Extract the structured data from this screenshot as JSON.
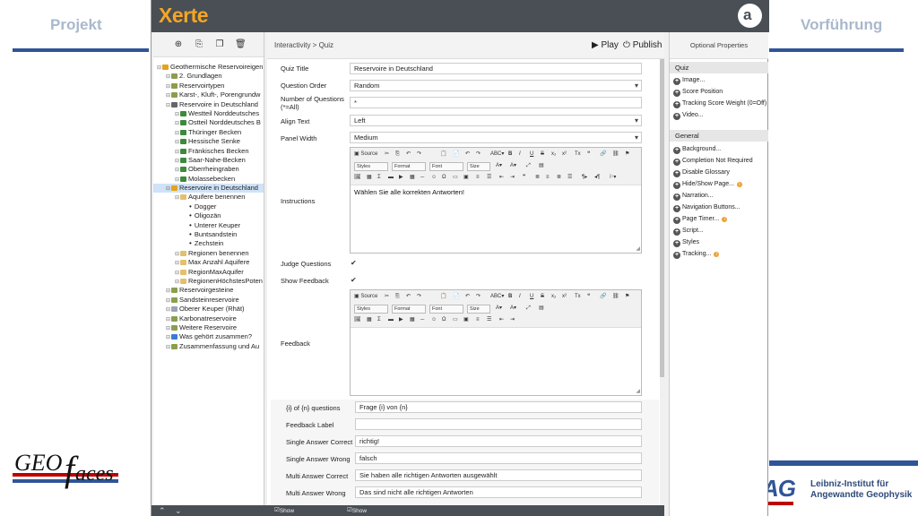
{
  "slide": {
    "left_tab": "Projekt",
    "right_tab": "Vorführung",
    "geo_logo": "GEOfaces",
    "liag_mark": "AG",
    "liag_line1": "Leibniz-Institut für",
    "liag_line2": "Angewandte Geophysik"
  },
  "app": {
    "logo": "Xerte",
    "right_logo": "a"
  },
  "tree": {
    "items": [
      {
        "label": "Geothermische Reservoireigen",
        "level": 0,
        "icon": "folder-icon",
        "color": "#e3a41c"
      },
      {
        "label": "2. Grundlagen",
        "level": 1,
        "icon": "page-icon",
        "color": "#8a9e4e"
      },
      {
        "label": "Reservoirtypen",
        "level": 1,
        "icon": "page-icon",
        "color": "#8a9e4e"
      },
      {
        "label": "Karst-, Kluft-, Porengrundw",
        "level": 1,
        "icon": "page-icon",
        "color": "#8a9e4e"
      },
      {
        "label": "Reservoire in Deutschland",
        "level": 1,
        "icon": "page-icon",
        "color": "#666666"
      },
      {
        "label": "Westteil Norddeutsches",
        "level": 2,
        "icon": "page-icon",
        "color": "#3c8a3c"
      },
      {
        "label": "Ostteil Norddeutsches B",
        "level": 2,
        "icon": "page-icon",
        "color": "#3c8a3c"
      },
      {
        "label": "Thüringer Becken",
        "level": 2,
        "icon": "page-icon",
        "color": "#3c8a3c"
      },
      {
        "label": "Hessische Senke",
        "level": 2,
        "icon": "page-icon",
        "color": "#3c8a3c"
      },
      {
        "label": "Fränkisches Becken",
        "level": 2,
        "icon": "page-icon",
        "color": "#3c8a3c"
      },
      {
        "label": "Saar-Nahe-Becken",
        "level": 2,
        "icon": "page-icon",
        "color": "#3c8a3c"
      },
      {
        "label": "Oberrheingraben",
        "level": 2,
        "icon": "page-icon",
        "color": "#3c8a3c"
      },
      {
        "label": "Molassebecken",
        "level": 2,
        "icon": "page-icon",
        "color": "#3c8a3c"
      },
      {
        "label": "Reservoire in Deutschland",
        "level": 1,
        "icon": "quiz-icon",
        "color": "#e3a41c",
        "selected": true
      },
      {
        "label": "Aquifere benennen",
        "level": 2,
        "icon": "question-icon",
        "color": "#e3c06b"
      },
      {
        "label": "Dogger",
        "level": 3,
        "icon": "bullet-icon",
        "color": "#222222"
      },
      {
        "label": "Oligozän",
        "level": 3,
        "icon": "bullet-icon",
        "color": "#222222"
      },
      {
        "label": "Unterer Keuper",
        "level": 3,
        "icon": "bullet-icon",
        "color": "#222222"
      },
      {
        "label": "Buntsandstein",
        "level": 3,
        "icon": "bullet-icon",
        "color": "#222222"
      },
      {
        "label": "Zechstein",
        "level": 3,
        "icon": "bullet-icon",
        "color": "#222222"
      },
      {
        "label": "Regionen benennen",
        "level": 2,
        "icon": "question-icon",
        "color": "#e3c06b"
      },
      {
        "label": "Max Anzahl Aquifere",
        "level": 2,
        "icon": "question-icon",
        "color": "#e3c06b"
      },
      {
        "label": "RegionMaxAquifer",
        "level": 2,
        "icon": "question-icon",
        "color": "#e3c06b"
      },
      {
        "label": "RegionenHöchstesPoten",
        "level": 2,
        "icon": "question-icon",
        "color": "#e3c06b"
      },
      {
        "label": "Reservoirgesteine",
        "level": 1,
        "icon": "page-icon",
        "color": "#8a9e4e"
      },
      {
        "label": "Sandsteinreservoire",
        "level": 1,
        "icon": "page-icon",
        "color": "#8a9e4e"
      },
      {
        "label": "Oberer Keuper (Rhät)",
        "level": 1,
        "icon": "doc-icon",
        "color": "#9aa4b4"
      },
      {
        "label": "Karbonatreservoire",
        "level": 1,
        "icon": "page-icon",
        "color": "#8a9e4e"
      },
      {
        "label": "Weitere Reservoire",
        "level": 1,
        "icon": "page-icon",
        "color": "#8a9e4e"
      },
      {
        "label": "Was gehört zusammen?",
        "level": 1,
        "icon": "drag-icon",
        "color": "#3a7bd5"
      },
      {
        "label": "Zusammenfassung und Au",
        "level": 1,
        "icon": "page-icon",
        "color": "#8a9e4e"
      }
    ]
  },
  "main": {
    "breadcrumb": "Interactivity > Quiz",
    "play": "▶ Play",
    "publish": "⏻ Publish",
    "fields": {
      "quiz_title_label": "Quiz Title",
      "quiz_title_value": "Reservoire in Deutschland",
      "question_order_label": "Question Order",
      "question_order_value": "Random",
      "num_questions_label": "Number of Questions",
      "num_questions_label2": "(*=All)",
      "num_questions_value": "*",
      "align_text_label": "Align Text",
      "align_text_value": "Left",
      "panel_width_label": "Panel Width",
      "panel_width_value": "Medium",
      "instructions_label": "Instructions",
      "instructions_value": "Wählen Sie alle korrekten Antworten!",
      "judge_label": "Judge Questions",
      "show_feedback_label": "Show Feedback",
      "feedback_label": "Feedback",
      "feedback_value": ""
    },
    "toolbar": {
      "source": "Source",
      "styles": "Styles",
      "format": "Format",
      "font": "Font",
      "size": "Size"
    },
    "language": {
      "of_questions_label": "{i} of {n} questions",
      "of_questions_value": "Frage {i} von {n}",
      "feedback_label_label": "Feedback Label",
      "feedback_label_value": "",
      "single_correct_label": "Single Answer Correct",
      "single_correct_value": "richtig!",
      "single_wrong_label": "Single Answer Wrong",
      "single_wrong_value": "falsch",
      "multi_correct_label": "Multi Answer Correct",
      "multi_correct_value": "Sie haben alle richtigen Antworten ausgewählt",
      "multi_wrong_label": "Multi Answer Wrong",
      "multi_wrong_value": "Das sind nicht alle richtigen Antworten"
    },
    "bottom": {
      "show_language": "Show Language Options",
      "show_toolbar": "Show Toolbar"
    }
  },
  "props": {
    "title": "Optional Properties",
    "quiz_group": "Quiz",
    "quiz_items": [
      "Image...",
      "Score Position",
      "Tracking Score Weight (0=Off)",
      "Video..."
    ],
    "general_group": "General",
    "general_items": [
      {
        "label": "Background...",
        "info": false
      },
      {
        "label": "Completion Not Required",
        "info": false
      },
      {
        "label": "Disable Glossary",
        "info": false
      },
      {
        "label": "Hide/Show Page...",
        "info": true
      },
      {
        "label": "Narration...",
        "info": false
      },
      {
        "label": "Navigation Buttons...",
        "info": false
      },
      {
        "label": "Page Timer...",
        "info": true
      },
      {
        "label": "Script...",
        "info": false
      },
      {
        "label": "Styles",
        "info": false
      },
      {
        "label": "Tracking...",
        "info": true
      }
    ]
  }
}
